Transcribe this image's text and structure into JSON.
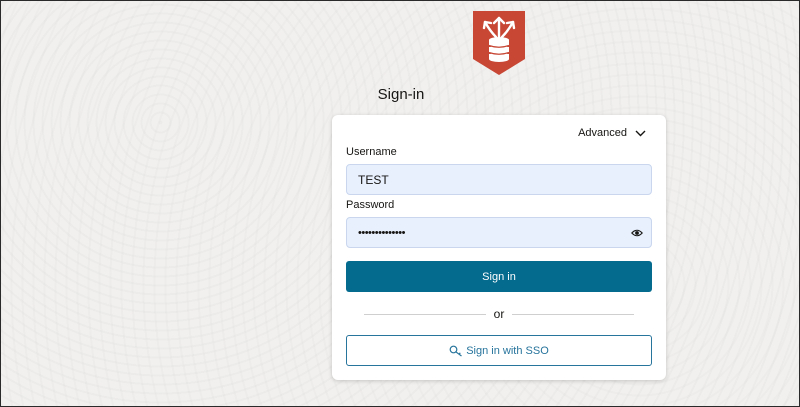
{
  "page": {
    "title": "Sign-in"
  },
  "logo": {
    "icon": "database-arrows-icon",
    "color": "#c74634"
  },
  "form": {
    "advanced_label": "Advanced",
    "username_label": "Username",
    "username_value": "TEST",
    "password_label": "Password",
    "password_masked": "••••••••••••••",
    "signin_label": "Sign in",
    "divider_text": "or",
    "sso_label": "Sign in with SSO"
  },
  "colors": {
    "primary": "#046b8f",
    "sso_accent": "#27749c",
    "field_bg": "#e8f0fe"
  }
}
